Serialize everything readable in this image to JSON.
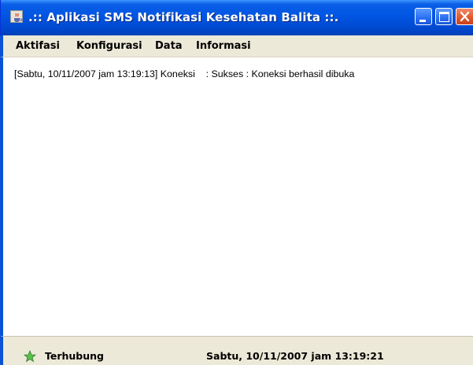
{
  "window": {
    "title": ".:: Aplikasi SMS Notifikasi Kesehatan Balita ::.",
    "app_icon": "java-cup-icon",
    "buttons": [
      "minimize-icon",
      "maximize-icon",
      "close-icon"
    ],
    "accent_color": "#0055e3"
  },
  "menu": {
    "items": [
      {
        "label": "Aktifasi"
      },
      {
        "label": "Konfigurasi"
      },
      {
        "label": "Data"
      },
      {
        "label": "Informasi"
      }
    ]
  },
  "log": {
    "lines": [
      "[Sabtu, 10/11/2007 jam 13:19:13] Koneksi    : Sukses : Koneksi berhasil dibuka"
    ]
  },
  "status": {
    "icon": "green-star-icon",
    "connection": "Terhubung",
    "datetime": "Sabtu, 10/11/2007 jam 13:19:21"
  }
}
